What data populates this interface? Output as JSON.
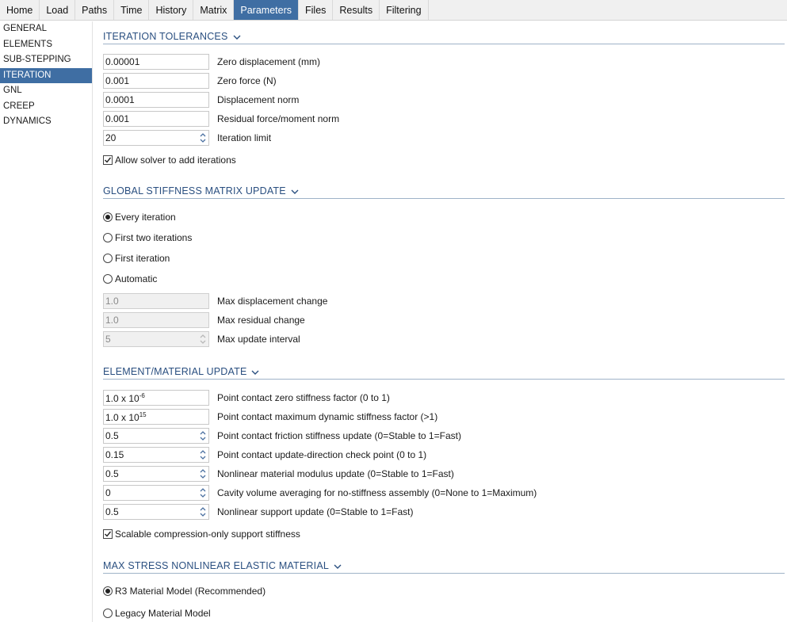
{
  "tabs": [
    {
      "label": "Home"
    },
    {
      "label": "Load"
    },
    {
      "label": "Paths"
    },
    {
      "label": "Time"
    },
    {
      "label": "History"
    },
    {
      "label": "Matrix"
    },
    {
      "label": "Parameters"
    },
    {
      "label": "Files"
    },
    {
      "label": "Results"
    },
    {
      "label": "Filtering"
    }
  ],
  "active_tab": "Parameters",
  "sidebar": {
    "items": [
      {
        "label": "GENERAL"
      },
      {
        "label": "ELEMENTS"
      },
      {
        "label": "SUB-STEPPING"
      },
      {
        "label": "ITERATION"
      },
      {
        "label": "GNL"
      },
      {
        "label": "CREEP"
      },
      {
        "label": "DYNAMICS"
      }
    ],
    "active": "ITERATION"
  },
  "iteration_tolerances": {
    "title": "ITERATION TOLERANCES",
    "fields": [
      {
        "value": "0.00001",
        "label": "Zero displacement (mm)"
      },
      {
        "value": "0.001",
        "label": "Zero force (N)"
      },
      {
        "value": "0.0001",
        "label": "Displacement norm"
      },
      {
        "value": "0.001",
        "label": "Residual force/moment norm"
      },
      {
        "value": "20",
        "label": "Iteration limit"
      }
    ],
    "allow_add_iterations": {
      "label": "Allow solver to add iterations",
      "checked": true
    }
  },
  "global_stiffness": {
    "title": "GLOBAL STIFFNESS MATRIX UPDATE",
    "options": [
      {
        "label": "Every iteration",
        "selected": true
      },
      {
        "label": "First two iterations",
        "selected": false
      },
      {
        "label": "First iteration",
        "selected": false
      },
      {
        "label": "Automatic",
        "selected": false
      }
    ],
    "fields": [
      {
        "value": "1.0",
        "label": "Max displacement change"
      },
      {
        "value": "1.0",
        "label": "Max residual change"
      },
      {
        "value": "5",
        "label": "Max update interval"
      }
    ]
  },
  "element_material": {
    "title": "ELEMENT/MATERIAL UPDATE",
    "sci_fields": [
      {
        "mantissa": "1.0 x 10",
        "exponent": "-6",
        "label": "Point contact zero stiffness factor (0 to 1)"
      },
      {
        "mantissa": "1.0 x 10",
        "exponent": "15",
        "label": "Point contact maximum dynamic stiffness factor (>1)"
      }
    ],
    "fields": [
      {
        "value": "0.5",
        "label": "Point contact friction stiffness update (0=Stable to 1=Fast)"
      },
      {
        "value": "0.15",
        "label": "Point contact update-direction check point (0 to 1)"
      },
      {
        "value": "0.5",
        "label": "Nonlinear material modulus update (0=Stable to 1=Fast)"
      },
      {
        "value": "0",
        "label": "Cavity volume averaging for no-stiffness assembly (0=None to 1=Maximum)"
      },
      {
        "value": "0.5",
        "label": "Nonlinear support update (0=Stable to 1=Fast)"
      }
    ],
    "scalable_support": {
      "label": "Scalable compression-only support stiffness",
      "checked": true
    }
  },
  "max_stress": {
    "title": "MAX STRESS NONLINEAR ELASTIC MATERIAL",
    "options": [
      {
        "label": "R3 Material Model (Recommended)",
        "selected": true
      },
      {
        "label": "Legacy Material Model",
        "selected": false
      }
    ]
  },
  "colors": {
    "accent": "#3f6ea3",
    "section_title": "#2a4f80",
    "divider": "#9fb3c8"
  },
  "icons": {
    "section_toggle": "chevron-down-icon",
    "spinner": "spinner-arrows-icon",
    "check": "checkmark-icon"
  }
}
